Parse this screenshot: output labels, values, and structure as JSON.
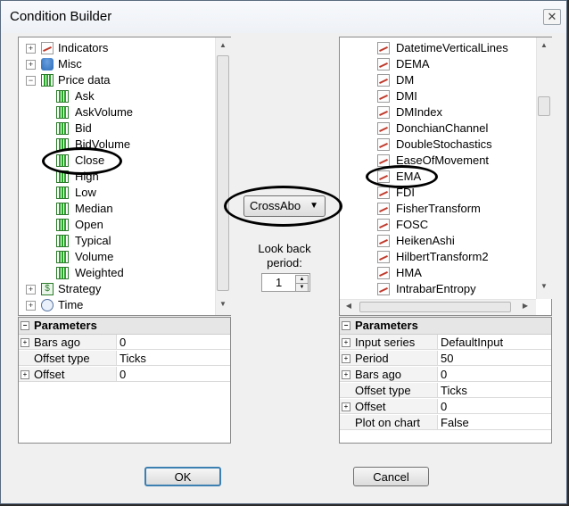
{
  "window": {
    "title": "Condition Builder"
  },
  "left_tree": {
    "items": [
      {
        "label": "Indicators",
        "expander": "+",
        "icon": "indicator-chart-icon",
        "level": 0
      },
      {
        "label": "Misc",
        "expander": "+",
        "icon": "database-icon",
        "level": 0
      },
      {
        "label": "Price data",
        "expander": "-",
        "icon": "bar-chart-icon",
        "level": 0
      },
      {
        "label": "Ask",
        "icon": "bar-chart-icon",
        "level": 1
      },
      {
        "label": "AskVolume",
        "icon": "bar-chart-icon",
        "level": 1
      },
      {
        "label": "Bid",
        "icon": "bar-chart-icon",
        "level": 1
      },
      {
        "label": "BidVolume",
        "icon": "bar-chart-icon",
        "level": 1
      },
      {
        "label": "Close",
        "icon": "bar-chart-icon",
        "level": 1
      },
      {
        "label": "High",
        "icon": "bar-chart-icon",
        "level": 1
      },
      {
        "label": "Low",
        "icon": "bar-chart-icon",
        "level": 1
      },
      {
        "label": "Median",
        "icon": "bar-chart-icon",
        "level": 1
      },
      {
        "label": "Open",
        "icon": "bar-chart-icon",
        "level": 1
      },
      {
        "label": "Typical",
        "icon": "bar-chart-icon",
        "level": 1
      },
      {
        "label": "Volume",
        "icon": "bar-chart-icon",
        "level": 1
      },
      {
        "label": "Weighted",
        "icon": "bar-chart-icon",
        "level": 1
      },
      {
        "label": "Strategy",
        "expander": "+",
        "icon": "dollar-icon",
        "level": 0
      },
      {
        "label": "Time",
        "expander": "+",
        "icon": "clock-icon",
        "level": 0
      }
    ]
  },
  "right_tree": {
    "items": [
      "DatetimeVerticalLines",
      "DEMA",
      "DM",
      "DMI",
      "DMIndex",
      "DonchianChannel",
      "DoubleStochastics",
      "EaseOfMovement",
      "EMA",
      "FDI",
      "FisherTransform",
      "FOSC",
      "HeikenAshi",
      "HilbertTransform2",
      "HMA",
      "IntrabarEntropy"
    ]
  },
  "left_params": {
    "header": "Parameters",
    "rows": [
      {
        "name": "Bars ago",
        "value": "0",
        "expander": "+"
      },
      {
        "name": "Offset type",
        "value": "Ticks",
        "expander": ""
      },
      {
        "name": "Offset",
        "value": "0",
        "expander": "+"
      }
    ]
  },
  "right_params": {
    "header": "Parameters",
    "rows": [
      {
        "name": "Input series",
        "value": "DefaultInput",
        "expander": "+"
      },
      {
        "name": "Period",
        "value": "50",
        "expander": "+"
      },
      {
        "name": "Bars ago",
        "value": "0",
        "expander": "+"
      },
      {
        "name": "Offset type",
        "value": "Ticks",
        "expander": ""
      },
      {
        "name": "Offset",
        "value": "0",
        "expander": "+"
      },
      {
        "name": "Plot on chart",
        "value": "False",
        "expander": ""
      }
    ]
  },
  "middle": {
    "condition": "CrossAbo",
    "lookback_label": "Look back\nperiod:",
    "lookback_value": "1"
  },
  "buttons": {
    "ok": "OK",
    "cancel": "Cancel"
  }
}
